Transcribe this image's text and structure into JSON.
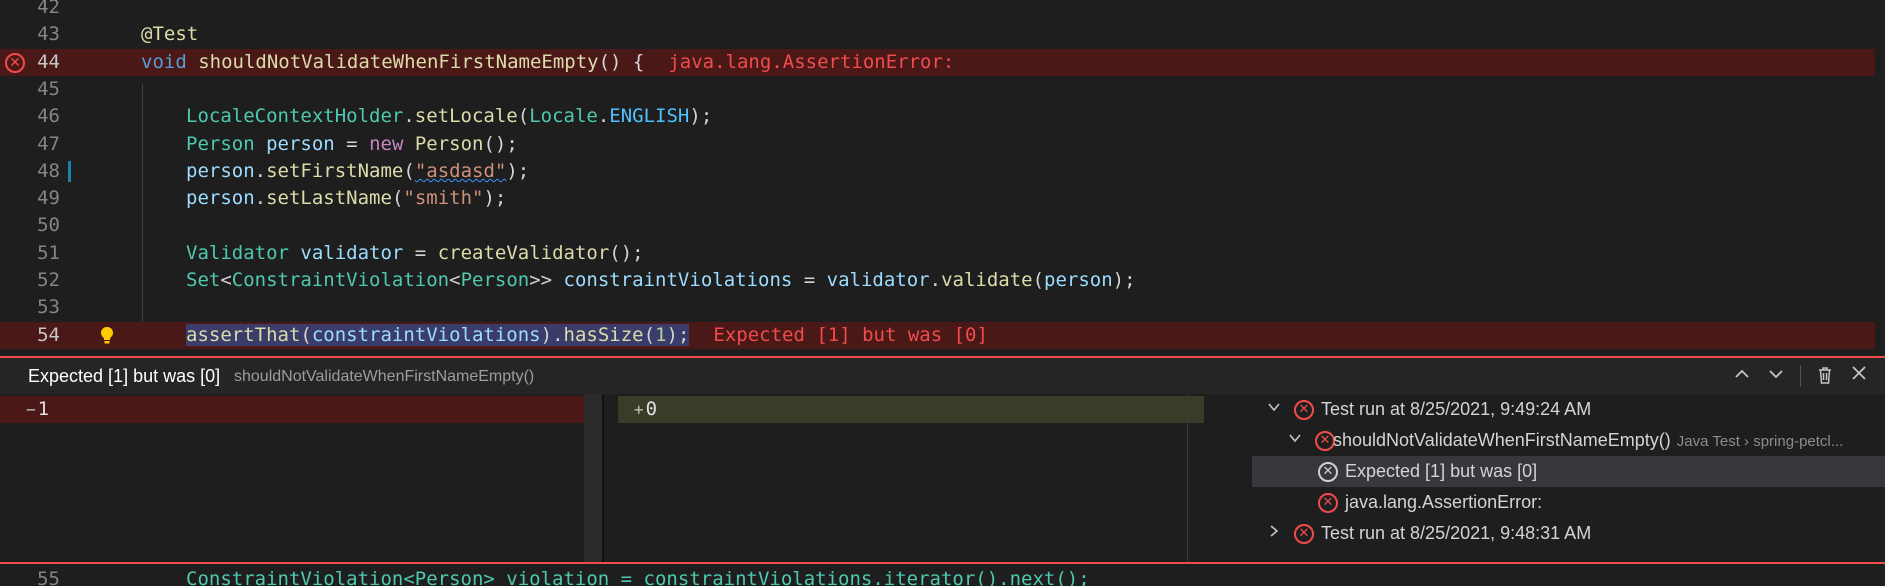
{
  "editor": {
    "lines": [
      {
        "num": "42",
        "parts": []
      },
      {
        "num": "43",
        "parts": [
          [
            "ann",
            "@Test"
          ]
        ]
      },
      {
        "num": "44",
        "parts": [
          [
            "kw",
            "void"
          ],
          [
            "sp",
            " "
          ],
          [
            "fn",
            "shouldNotValidateWhenFirstNameEmpty"
          ],
          [
            "punc",
            "() {"
          ]
        ],
        "error": "java.lang.AssertionError:"
      },
      {
        "num": "45",
        "parts": []
      },
      {
        "num": "46",
        "parts": [
          [
            "type",
            "LocaleContextHolder"
          ],
          [
            "punc",
            "."
          ],
          [
            "fn",
            "setLocale"
          ],
          [
            "punc",
            "("
          ],
          [
            "type",
            "Locale"
          ],
          [
            "punc",
            "."
          ],
          [
            "const",
            "ENGLISH"
          ],
          [
            "punc",
            ");"
          ]
        ]
      },
      {
        "num": "47",
        "parts": [
          [
            "type",
            "Person"
          ],
          [
            "sp",
            " "
          ],
          [
            "var",
            "person"
          ],
          [
            "punc",
            " = "
          ],
          [
            "new",
            "new"
          ],
          [
            "sp",
            " "
          ],
          [
            "fn",
            "Person"
          ],
          [
            "punc",
            "();"
          ]
        ]
      },
      {
        "num": "48",
        "parts": [
          [
            "var",
            "person"
          ],
          [
            "punc",
            "."
          ],
          [
            "fn",
            "setFirstName"
          ],
          [
            "punc",
            "("
          ],
          [
            "str",
            "\"asdasd\""
          ],
          [
            "punc",
            ");"
          ]
        ]
      },
      {
        "num": "49",
        "parts": [
          [
            "var",
            "person"
          ],
          [
            "punc",
            "."
          ],
          [
            "fn",
            "setLastName"
          ],
          [
            "punc",
            "("
          ],
          [
            "str",
            "\"smith\""
          ],
          [
            "punc",
            ");"
          ]
        ]
      },
      {
        "num": "50",
        "parts": []
      },
      {
        "num": "51",
        "parts": [
          [
            "type",
            "Validator"
          ],
          [
            "sp",
            " "
          ],
          [
            "var",
            "validator"
          ],
          [
            "punc",
            " = "
          ],
          [
            "fn",
            "createValidator"
          ],
          [
            "punc",
            "();"
          ]
        ]
      },
      {
        "num": "52",
        "parts": [
          [
            "type",
            "Set"
          ],
          [
            "punc",
            "<"
          ],
          [
            "type",
            "ConstraintViolation"
          ],
          [
            "punc",
            "<"
          ],
          [
            "type",
            "Person"
          ],
          [
            "punc",
            ">> "
          ],
          [
            "var",
            "constraintViolations"
          ],
          [
            "punc",
            " = "
          ],
          [
            "var",
            "validator"
          ],
          [
            "punc",
            "."
          ],
          [
            "fn",
            "validate"
          ],
          [
            "punc",
            "("
          ],
          [
            "var",
            "person"
          ],
          [
            "punc",
            ");"
          ]
        ]
      },
      {
        "num": "53",
        "parts": []
      },
      {
        "num": "54",
        "parts": [
          [
            "fn",
            "assertThat"
          ],
          [
            "punc",
            "("
          ],
          [
            "var",
            "constraintViolations"
          ],
          [
            "punc",
            ")."
          ],
          [
            "fn",
            "hasSize"
          ],
          [
            "punc",
            "("
          ],
          [
            "num",
            "1"
          ],
          [
            "punc",
            ");"
          ]
        ],
        "error": "Expected [1] but was [0]"
      }
    ],
    "next_line_num": "55",
    "next_line_text": "ConstraintViolation<Person> violation = constraintViolations.iterator().next();"
  },
  "peek": {
    "title": "Expected [1] but was [0]",
    "subtitle": "shouldNotValidateWhenFirstNameEmpty()",
    "expected_value": "1",
    "actual_value": "0",
    "minus_sign": "−",
    "plus_sign": "+",
    "tree": [
      {
        "label": "Test run at 8/25/2021, 9:49:24 AM",
        "desc": ""
      },
      {
        "label": "shouldNotValidateWhenFirstNameEmpty()",
        "desc": "Java Test › spring-petcl..."
      },
      {
        "label": "Expected [1] but was [0]",
        "desc": ""
      },
      {
        "label": "java.lang.AssertionError:",
        "desc": ""
      },
      {
        "label": "Test run at 8/25/2021, 9:48:31 AM",
        "desc": ""
      }
    ]
  },
  "icons": {
    "error": "error-circle-icon",
    "bulb": "lightbulb-icon",
    "chevron_up": "chevron-up-icon",
    "chevron_down": "chevron-down-icon",
    "trash": "trash-icon",
    "close": "close-icon"
  },
  "colors": {
    "error": "#f14c4c",
    "error_line_bg": "#4b1818",
    "added_bg": "#373d29",
    "editor_bg": "#1e1e1e"
  }
}
